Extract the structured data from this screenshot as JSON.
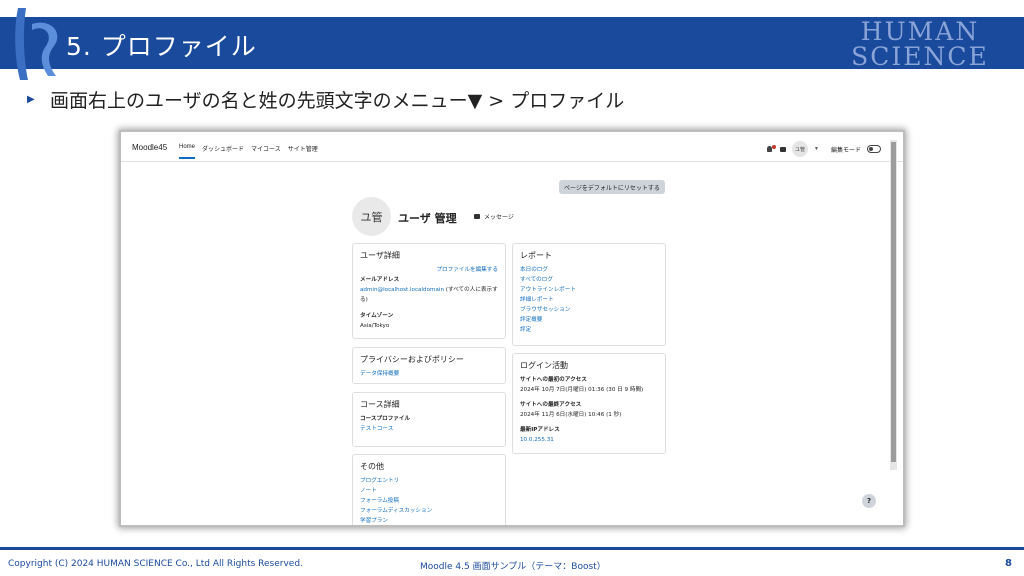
{
  "slide": {
    "title": "5. プロファイル",
    "brand_line1": "HUMAN",
    "brand_line2": "SCIENCE",
    "bullet": "画面右上のユーザの名と姓の先頭文字のメニュー▼ > プロファイル",
    "footer_copyright": "Copyright (C) 2024 HUMAN SCIENCE Co., Ltd All Rights Reserved.",
    "footer_center": "Moodle 4.5 画面サンプル（テーマ：Boost）",
    "page_number": "8",
    "accent_color": "#1a4a9c"
  },
  "navbar": {
    "site_name": "Moodle45",
    "items": [
      "Home",
      "ダッシュボード",
      "マイコース",
      "サイト管理"
    ],
    "active_item": "Home",
    "user_initials": "ユ管",
    "edit_mode_label": "編集モード",
    "icons": [
      "bell-icon",
      "chat-icon",
      "chevron-down-icon",
      "toggle-switch"
    ]
  },
  "profile": {
    "reset_button": "ページをデフォルトにリセットする",
    "avatar_initials": "ユ管",
    "user_name": "ユーザ 管理",
    "message_link": "メッセージ"
  },
  "user_details": {
    "title": "ユーザ詳細",
    "edit_profile_link": "プロファイルを編集する",
    "email_label": "メールアドレス",
    "email_value": "admin@localhost.localdomain",
    "email_visibility": "(すべての人に表示する)",
    "timezone_label": "タイムゾーン",
    "timezone_value": "Asia/Tokyo"
  },
  "privacy": {
    "title": "プライバシーおよびポリシー",
    "items": [
      "データ保持概要"
    ]
  },
  "course_details": {
    "title": "コース詳細",
    "profile_label": "コースプロファイル",
    "items": [
      "テストコース"
    ]
  },
  "misc": {
    "title": "その他",
    "items": [
      "ブログエントリ",
      "ノート",
      "フォーラム投稿",
      "フォーラムディスカッション",
      "学習プラン"
    ]
  },
  "reports": {
    "title": "レポート",
    "items": [
      "本日のログ",
      "すべてのログ",
      "アウトラインレポート",
      "詳細レポート",
      "ブラウザセッション",
      "評定概要",
      "評定"
    ]
  },
  "login_activity": {
    "title": "ログイン活動",
    "first_access_label": "サイトへの最初のアクセス",
    "first_access_value": "2024年 10月 7日(月曜日) 01:36  (30 日 9 時間)",
    "last_access_label": "サイトへの最終アクセス",
    "last_access_value": "2024年 11月 6日(水曜日) 10:46  (1 秒)",
    "last_ip_label": "最新IPアドレス",
    "last_ip_value": "10.0.255.31"
  },
  "help_button": "?"
}
